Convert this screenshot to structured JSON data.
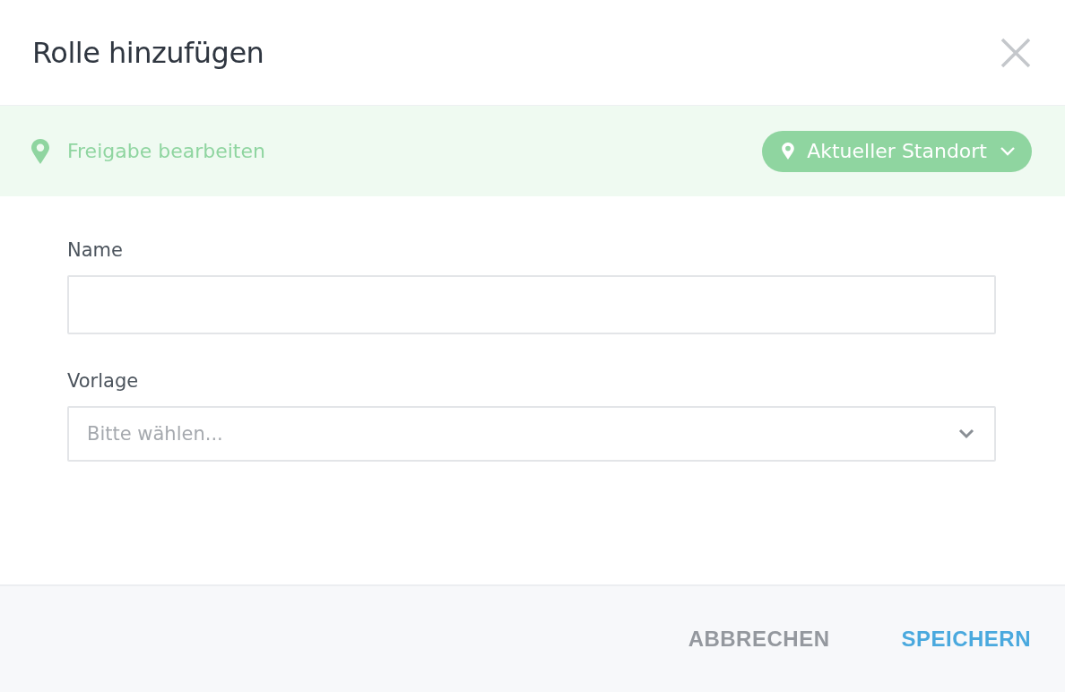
{
  "dialog": {
    "title": "Rolle hinzufügen"
  },
  "share_bar": {
    "label": "Freigabe bearbeiten",
    "location_button": "Aktueller Standort"
  },
  "fields": [
    {
      "kind": "text",
      "label": "Name"
    },
    {
      "kind": "select",
      "label": "Vorlage",
      "placeholder": "Bitte wählen..."
    }
  ],
  "buttons": [
    {
      "kind": "secondary",
      "label": "ABBRECHEN"
    },
    {
      "kind": "primary",
      "label": "SPEICHERN"
    }
  ]
}
